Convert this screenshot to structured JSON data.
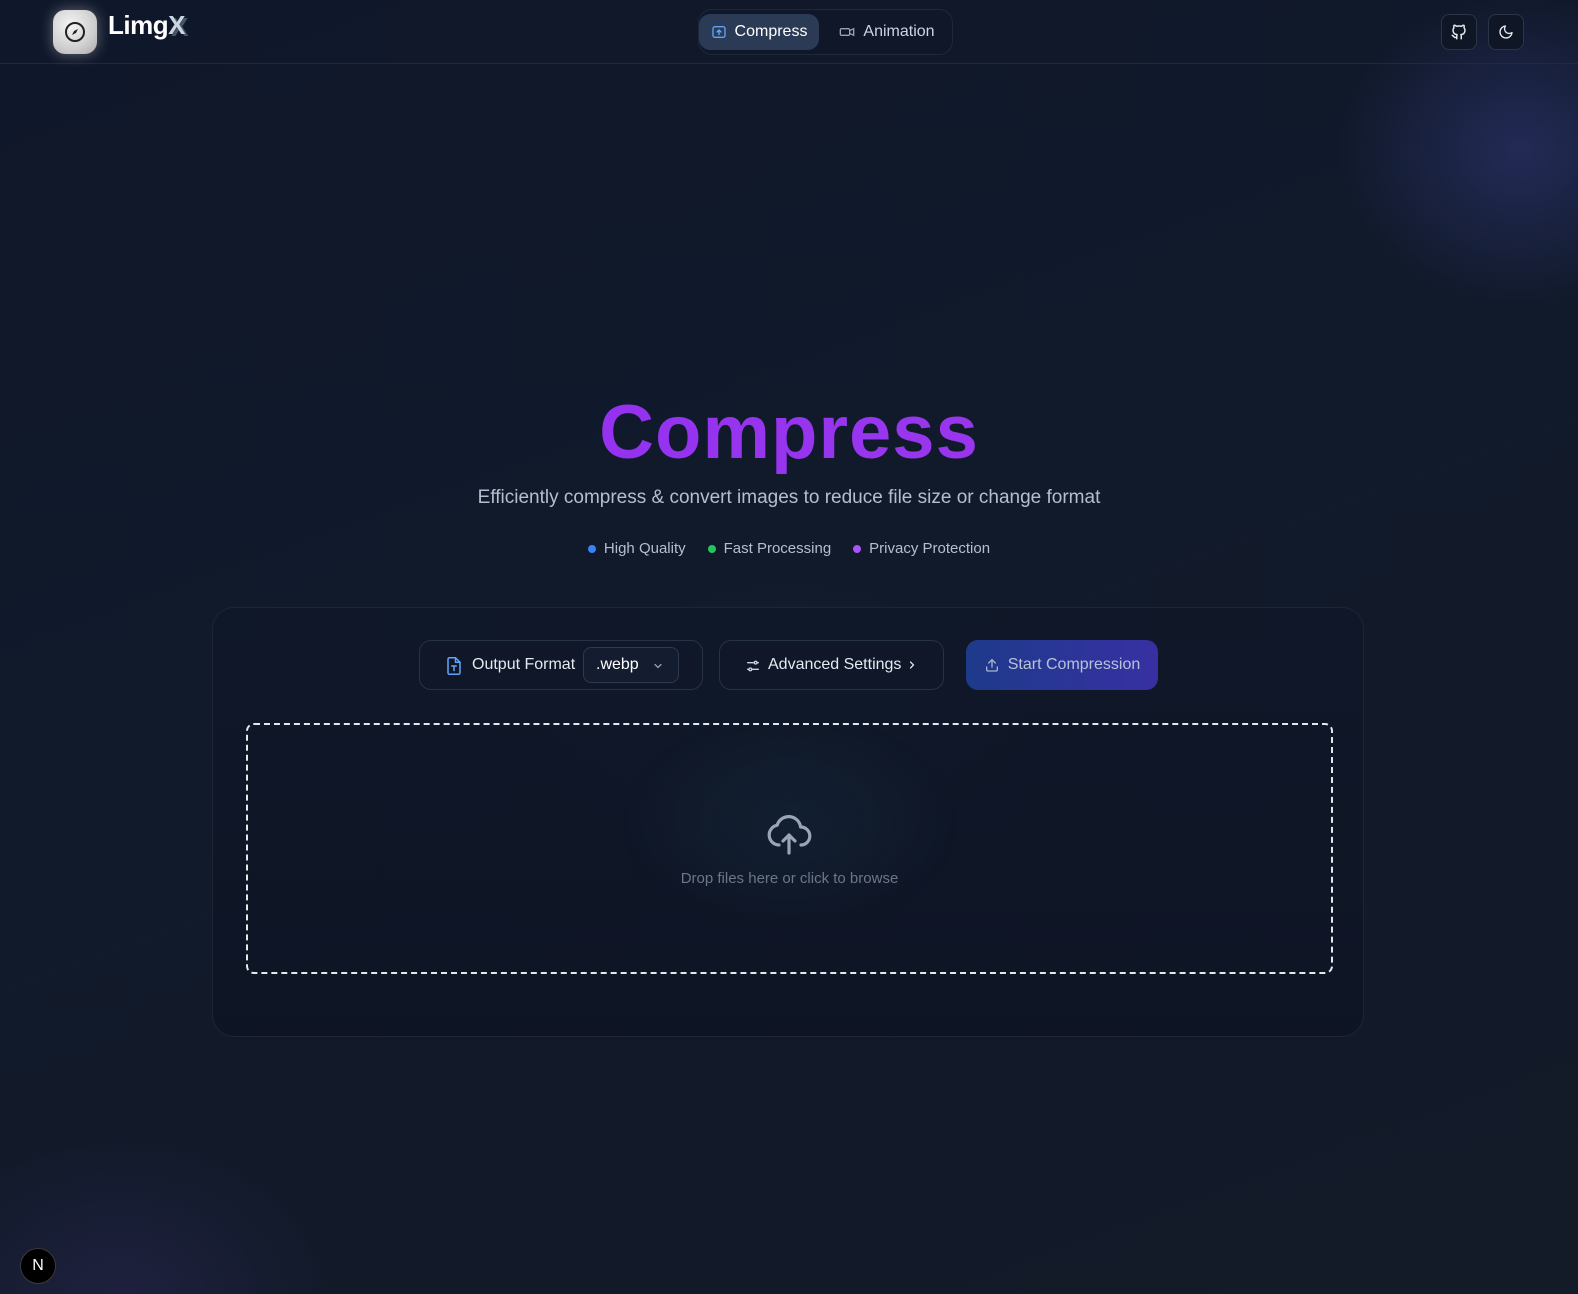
{
  "header": {
    "brand_main": "Limg",
    "brand_accent": "X",
    "logo_icon": "compass-icon",
    "nav_tabs": [
      {
        "label": "Compress",
        "icon": "image-upload-icon",
        "active": true
      },
      {
        "label": "Animation",
        "icon": "video-icon",
        "active": false
      }
    ],
    "github_icon": "github-icon",
    "theme_icon": "moon-icon"
  },
  "hero": {
    "title": "Compress",
    "subtitle": "Efficiently compress & convert images to reduce file size or change format",
    "features": [
      {
        "label": "High Quality",
        "color": "#3b82f6"
      },
      {
        "label": "Fast Processing",
        "color": "#22c55e"
      },
      {
        "label": "Privacy Protection",
        "color": "#a855f7"
      }
    ]
  },
  "toolbar": {
    "output_format_label": "Output Format",
    "output_format_value": ".webp",
    "advanced_settings_label": "Advanced Settings",
    "start_label": "Start Compression"
  },
  "dropzone": {
    "text": "Drop files here or click to browse",
    "icon": "cloud-upload-icon"
  },
  "corner_badge": "N",
  "colors": {
    "accent": "#9333ea",
    "primary_button": "#1e3a8a"
  }
}
